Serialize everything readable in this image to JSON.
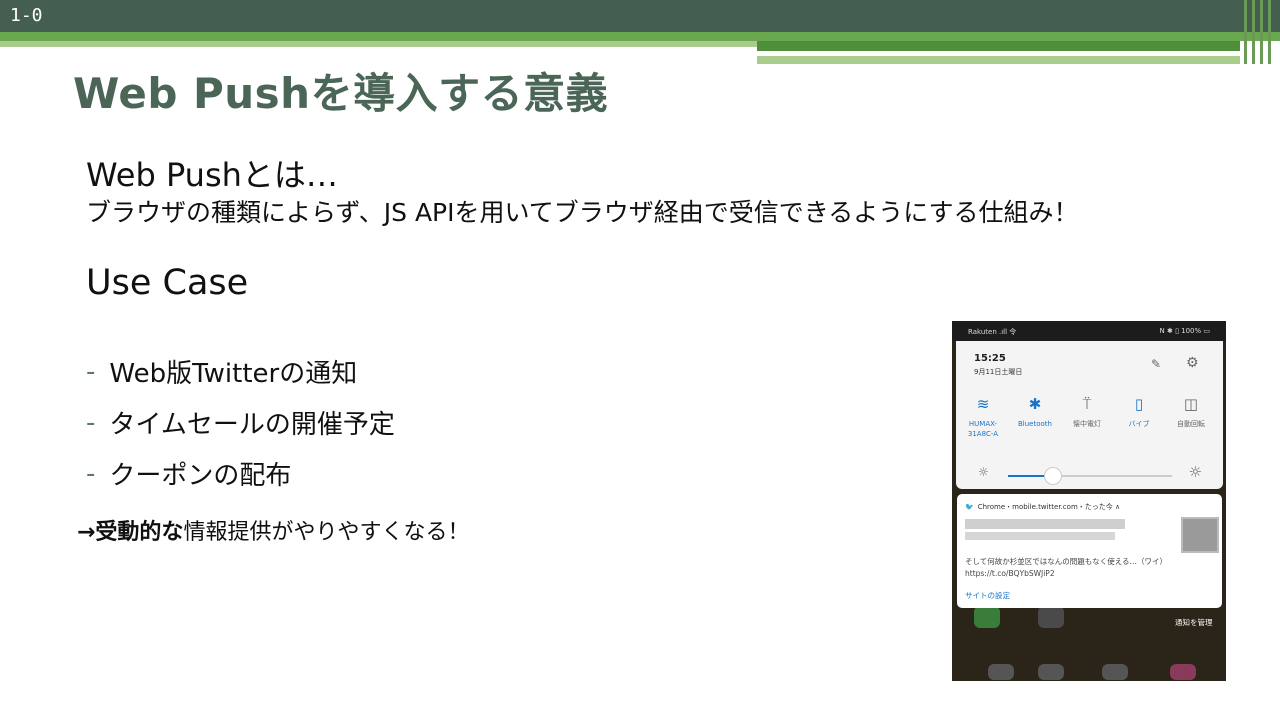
{
  "slide": {
    "number": "1-0",
    "title": "Web Pushを導入する意義",
    "heading_web_push": "Web Pushとは…",
    "description": "ブラウザの種類によらず、JS APIを用いてブラウザ経由で受信できるようにする仕組み！",
    "heading_use_case": "Use Case",
    "use_cases": [
      {
        "dash": "-",
        "text": "Web版Twitterの通知"
      },
      {
        "dash": "-",
        "text": "タイムセールの開催予定"
      },
      {
        "dash": "-",
        "text": "クーポンの配布"
      }
    ],
    "conclusion": {
      "arrow_bold": "→受動的な",
      "rest": "情報提供がやりやすくなる！"
    }
  },
  "phone": {
    "status_left": "Rakuten .ıll 令",
    "status_right": "N ✱ ▯ 100% ▭",
    "time": "15:25",
    "date": "9月11日土曜日",
    "edit_icon": "pencil-icon",
    "settings_icon": "gear-icon",
    "tiles": [
      {
        "icon": "wifi-icon",
        "glyph": "≋",
        "label": "HUMAX-\n31A8C-A",
        "active": true
      },
      {
        "icon": "bluetooth-icon",
        "glyph": "✱",
        "label": "Bluetooth",
        "active": true
      },
      {
        "icon": "flashlight-icon",
        "glyph": "⍡",
        "label": "懐中電灯",
        "active": false
      },
      {
        "icon": "vibrate-icon",
        "glyph": "▯",
        "label": "バイブ",
        "active": true
      },
      {
        "icon": "auto-rotate-icon",
        "glyph": "◫",
        "label": "自動回転",
        "active": false
      }
    ],
    "brightness_level": 0.27,
    "notification": {
      "app": "Chrome・mobile.twitter.com・たった今 ∧",
      "body": "そして何故か杉並区ではなんの問題もなく使える…（ワイ） https://t.co/BQYbSWJiP2",
      "settings_link": "サイトの設定"
    },
    "manage_label": "通知を管理"
  },
  "colors": {
    "header_dark": "#445e4f",
    "accent_green": "#6aa84f",
    "title_green": "#4b6657",
    "link_blue": "#1a73c9"
  }
}
